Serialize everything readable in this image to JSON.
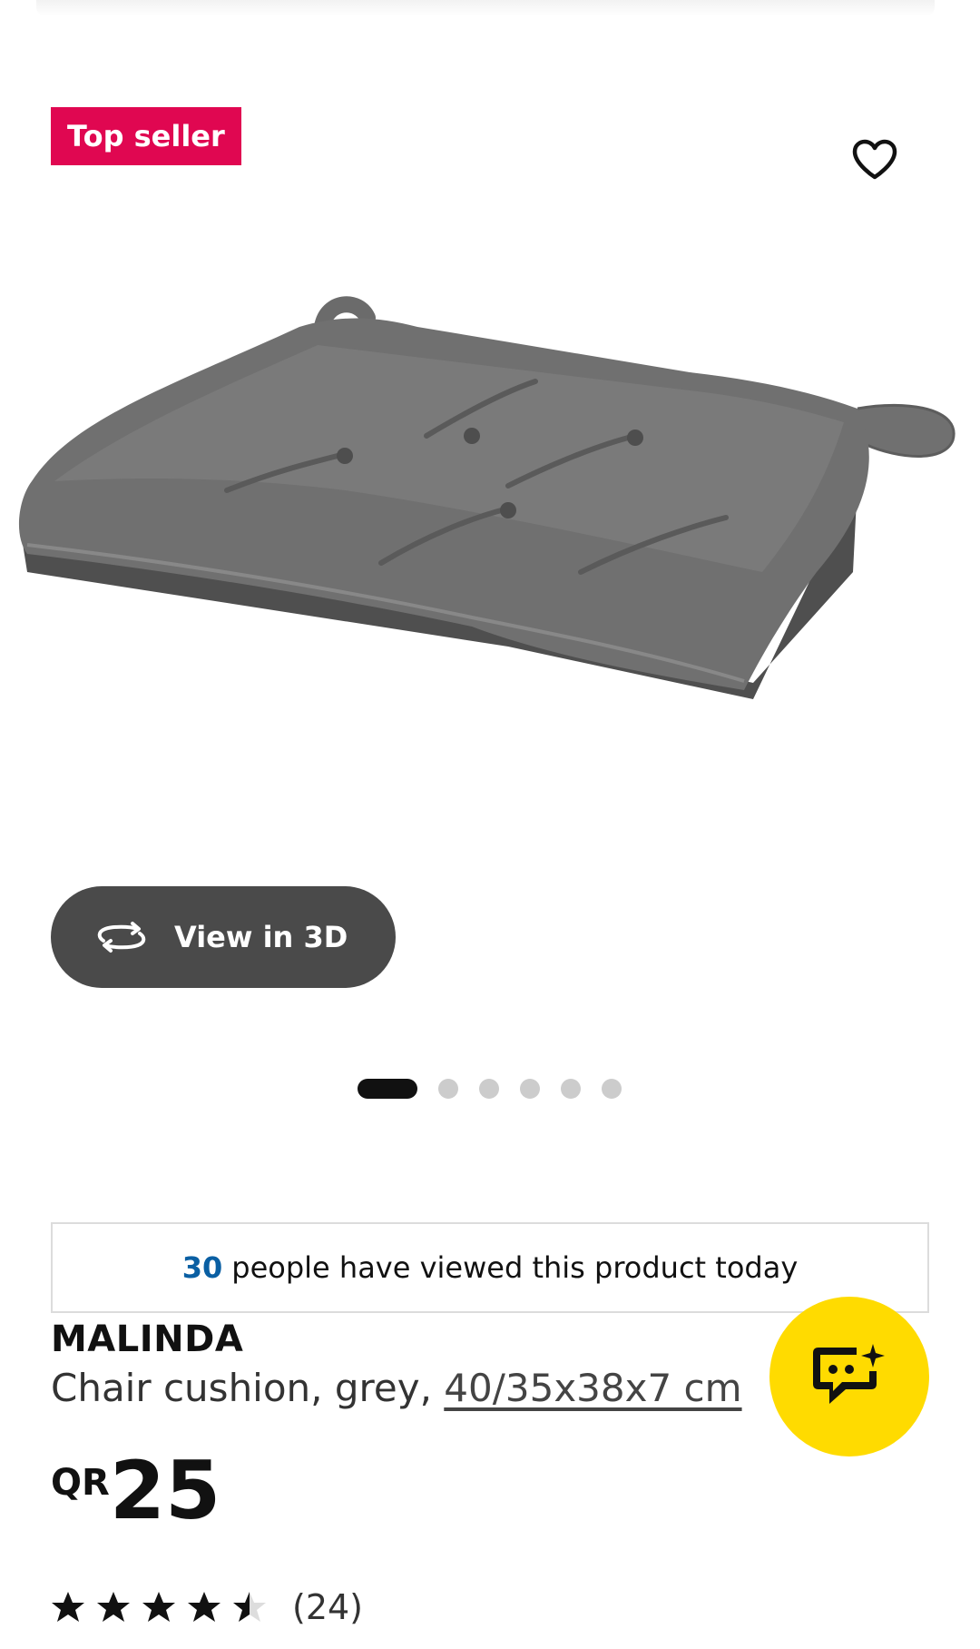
{
  "badge": {
    "label": "Top seller",
    "color": "#e00751"
  },
  "favourite": {
    "icon": "heart-outline-icon"
  },
  "product_image": {
    "description_icon": "grey-chair-cushion-image"
  },
  "view_3d": {
    "label": "View in 3D",
    "icon": "rotate-3d-icon"
  },
  "carousel": {
    "total": 6,
    "active_index": 1
  },
  "social_proof": {
    "count": "30",
    "text": "people have viewed this product today"
  },
  "product": {
    "name": "MALINDA",
    "description": "Chair cushion, grey, ",
    "size": "40/35x38x7 cm",
    "currency": "QR",
    "price": "25"
  },
  "rating": {
    "value": 4.5,
    "max": 5,
    "count_label": "(24)"
  },
  "chat": {
    "icon": "chat-assistant-icon",
    "color": "#ffdb00"
  }
}
